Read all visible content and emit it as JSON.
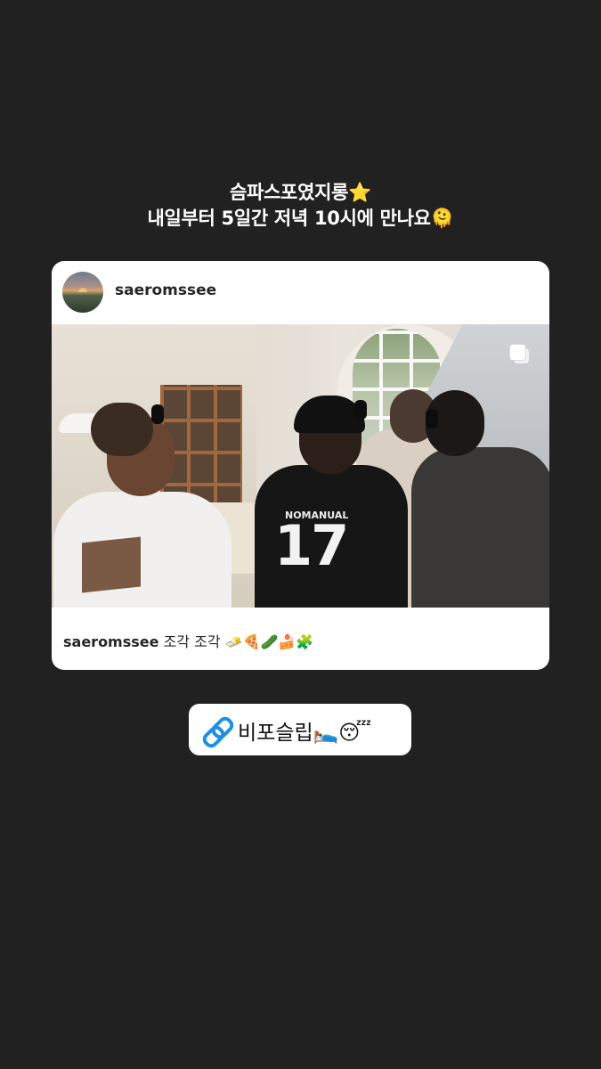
{
  "story": {
    "caption_lines": [
      "슴파스포였지롱⭐️",
      "내일부터 5일간 저녁 10시에 만나요🫠"
    ]
  },
  "post": {
    "username": "saeromssee",
    "caption_user": "saeromssee",
    "caption_text": "조각 조각 🧈🍕🥒🍰🧩",
    "photo": {
      "jersey_name": "NOMANUAL",
      "jersey_number": "17"
    },
    "icons": {
      "carousel": "carousel-icon"
    }
  },
  "link_sticker": {
    "label": "비포슬립🛌😴",
    "icon": "link-icon",
    "icon_color": "#1e8fe6"
  },
  "colors": {
    "background": "#212121",
    "card": "#ffffff",
    "text_dark": "#262626"
  }
}
